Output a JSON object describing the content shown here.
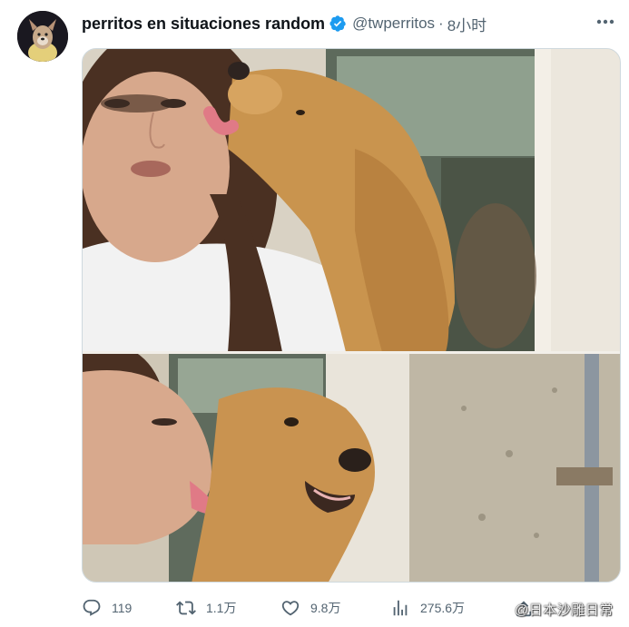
{
  "tweet": {
    "display_name": "perritos en situaciones random",
    "handle": "@twperritos",
    "separator": "·",
    "time": "8小时",
    "verified": true
  },
  "media": {
    "photos": [
      {
        "subject": "woman-and-golden-retriever-kiss"
      },
      {
        "subject": "woman-licking-golden-retriever"
      }
    ]
  },
  "actions": {
    "reply_count": "119",
    "retweet_count": "1.1万",
    "like_count": "9.8万",
    "views_count": "275.6万"
  },
  "watermark": {
    "text": "@日本沙雕日常",
    "logo": "weibo-logo"
  },
  "colors": {
    "verified_blue": "#1d9bf0",
    "secondary_text": "#536471",
    "primary_text": "#0f1419",
    "border": "#cfd9de"
  }
}
